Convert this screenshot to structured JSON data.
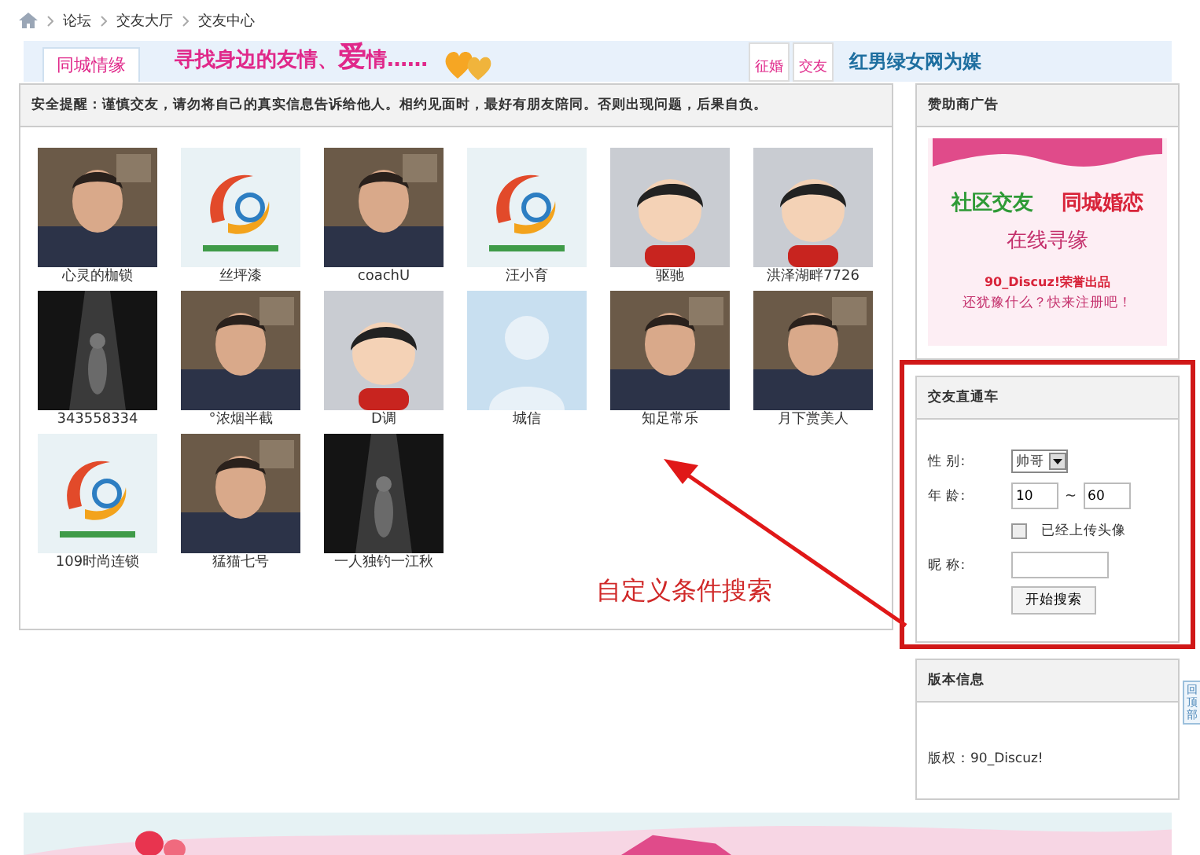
{
  "breadcrumb": [
    "论坛",
    "交友大厅",
    "交友中心"
  ],
  "banner": {
    "tab": "同城情缘",
    "slogan": "寻找身边的友情、**爱**情……",
    "badges": [
      "征婚",
      "交友"
    ],
    "tagline": "红男绿女网为媒"
  },
  "notice": "安全提醒：谨慎交友，请勿将自己的真实信息告诉给他人。相约见面时，最好有朋友陪同。否则出现问题，后果自负。",
  "members": [
    {
      "name": "心灵的枷锁"
    },
    {
      "name": "丝坪漆",
      "kind": "logo"
    },
    {
      "name": "coachU"
    },
    {
      "name": "汪小育",
      "kind": "logo"
    },
    {
      "name": "驱驰",
      "kind": "cartoon"
    },
    {
      "name": "洪泽湖畔7726",
      "kind": "cartoon"
    },
    {
      "name": "343558334",
      "kind": "dark"
    },
    {
      "name": "°浓烟半截"
    },
    {
      "name": "D调",
      "kind": "cartoon"
    },
    {
      "name": "城信",
      "kind": "blank"
    },
    {
      "name": "知足常乐"
    },
    {
      "name": "月下赏美人"
    },
    {
      "name": "109时尚连锁",
      "kind": "logo"
    },
    {
      "name": "猛猫七号"
    },
    {
      "name": "一人独钓一江秋",
      "kind": "dark"
    }
  ],
  "annotation": "自定义条件搜索",
  "sponsor": {
    "title": "赞助商广告",
    "lines": [
      "社区交友",
      "同城婚恋",
      "在线寻缘",
      "90_Discuz!荣誉出品",
      "还犹豫什么？快来注册吧！"
    ]
  },
  "search": {
    "title": "交友直通车",
    "gender_label": "性 别:",
    "gender": "帅哥",
    "age_label": "年 龄:",
    "age_from": "10",
    "age_sep": "~",
    "age_to": "60",
    "avatar_label": "已经上传头像",
    "avatar_checked": false,
    "nickname_label": "昵 称:",
    "button": "开始搜索"
  },
  "version": {
    "title": "版本信息",
    "copyright": "版权：90_Discuz!"
  },
  "back_to_top": "回顶部"
}
